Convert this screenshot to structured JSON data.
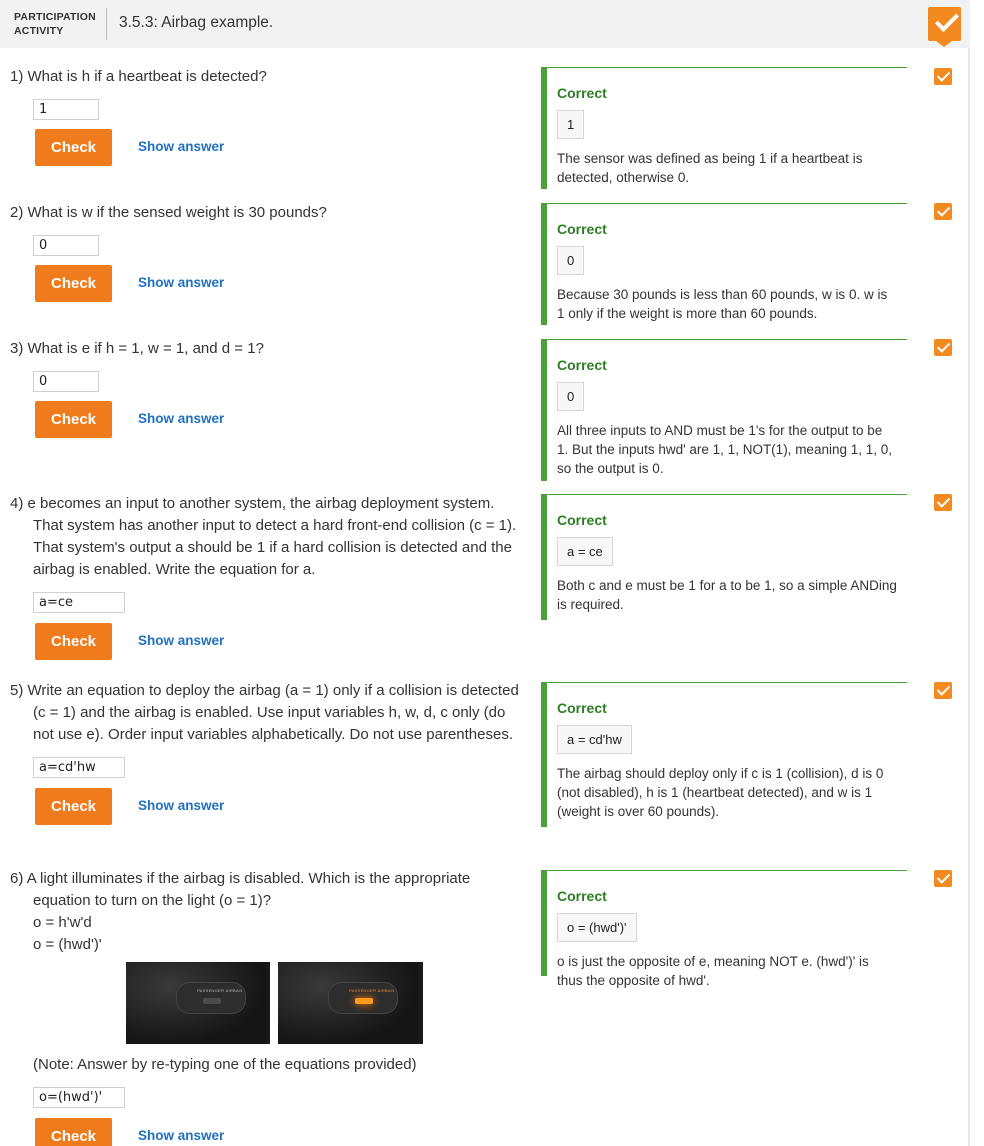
{
  "header": {
    "label_line1": "PARTICIPATION",
    "label_line2": "ACTIVITY",
    "title": "3.5.3: Airbag example.",
    "completion_icon": "check-icon",
    "badge_color": "#f28a1f"
  },
  "questions": [
    {
      "number": "1)",
      "text": "What is h if a heartbeat is detected?",
      "input_value": "1",
      "check_label": "Check",
      "show_answer_label": "Show answer",
      "feedback": {
        "status": "Correct",
        "answer": "1",
        "explanation": "The sensor was defined as being 1 if a heartbeat is detected, otherwise 0."
      }
    },
    {
      "number": "2)",
      "text": "What is w if the sensed weight is 30 pounds?",
      "input_value": "0",
      "check_label": "Check",
      "show_answer_label": "Show answer",
      "feedback": {
        "status": "Correct",
        "answer": "0",
        "explanation": "Because 30 pounds is less than 60 pounds, w is 0. w is 1 only if the weight is more than 60 pounds."
      }
    },
    {
      "number": "3)",
      "text": "What is e if h = 1, w = 1, and d = 1?",
      "input_value": "0",
      "check_label": "Check",
      "show_answer_label": "Show answer",
      "feedback": {
        "status": "Correct",
        "answer": "0",
        "explanation": "All three inputs to AND must be 1's for the output to be 1. But the inputs hwd' are 1, 1, NOT(1), meaning 1, 1, 0, so the output is 0."
      }
    },
    {
      "number": "4)",
      "text": "e becomes an input to another system, the airbag deployment system. That system has another input to detect a hard front-end collision (c = 1). That system's output a should be 1 if a hard collision is detected and the airbag is enabled. Write the equation for a.",
      "input_value": "a=ce",
      "check_label": "Check",
      "show_answer_label": "Show answer",
      "feedback": {
        "status": "Correct",
        "answer": "a = ce",
        "explanation": "Both c and e must be 1 for a to be 1, so a simple ANDing is required."
      }
    },
    {
      "number": "5)",
      "text": "Write an equation to deploy the airbag (a = 1) only if a collision is detected (c = 1) and the airbag is enabled. Use input variables h, w, d, c only (do not use e). Order input variables alphabetically. Do not use parentheses.",
      "input_value": "a=cd'hw",
      "check_label": "Check",
      "show_answer_label": "Show answer",
      "feedback": {
        "status": "Correct",
        "answer": "a = cd'hw",
        "explanation": "The airbag should deploy only if c is 1 (collision), d is 0 (not disabled), h is 1 (heartbeat detected), and w is 1 (weight is over 60 pounds)."
      }
    },
    {
      "number": "6)",
      "text": "A light illuminates if the airbag is disabled. Which is the appropriate equation to turn on the light (o = 1)?",
      "option1": "o = h'w'd",
      "option2": "o = (hwd')'",
      "photo_label": "PASSENGER AIRBAG",
      "photo_lamp": "OFF",
      "note": "(Note: Answer by re-typing one of the equations provided)",
      "input_value": "o=(hwd')'",
      "check_label": "Check",
      "show_answer_label": "Show answer",
      "feedback": {
        "status": "Correct",
        "answer": "o = (hwd')'",
        "explanation": "o is just the opposite of e, meaning NOT e. (hwd')' is thus the opposite of hwd'."
      }
    }
  ],
  "colors": {
    "check_button": "#f07b1d",
    "show_answer_link": "#1f71c0",
    "correct_border": "#4aa13a",
    "correct_text": "#2f7d27"
  }
}
